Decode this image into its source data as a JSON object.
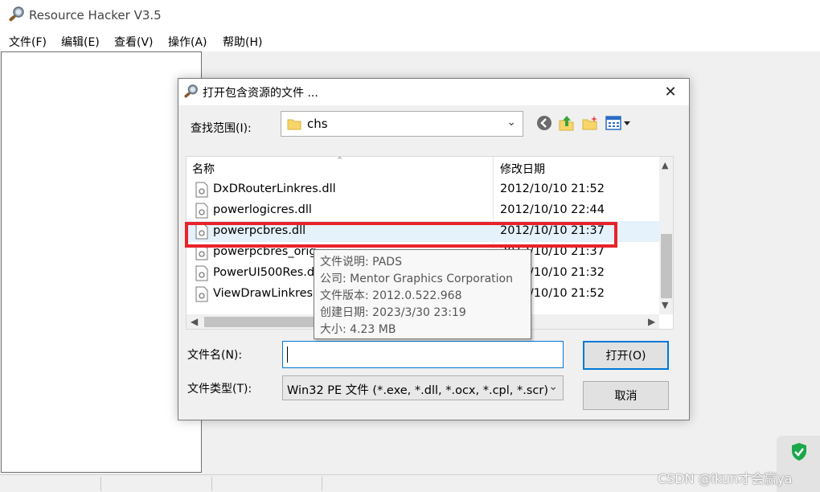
{
  "app": {
    "title": "Resource Hacker V3.5",
    "menu": [
      "文件(F)",
      "编辑(E)",
      "查看(V)",
      "操作(A)",
      "帮助(H)"
    ]
  },
  "dialog": {
    "title": "打开包含资源的文件 ...",
    "close_label": "✕",
    "look_in_label": "查找范围(I):",
    "look_in_value": "chs",
    "toolbar_icons": [
      "back-icon",
      "up-folder-icon",
      "new-folder-icon",
      "view-menu-icon"
    ],
    "columns": {
      "name": "名称",
      "modified": "修改日期"
    },
    "files": [
      {
        "name": "DxDRouterLinkres.dll",
        "date": "2012/10/10 21:52"
      },
      {
        "name": "powerlogicres.dll",
        "date": "2012/10/10 22:44"
      },
      {
        "name": "powerpcbres.dll",
        "date": "2012/10/10 21:37"
      },
      {
        "name": "powerpcbres_orig",
        "date": "2012/10/10 21:37"
      },
      {
        "name": "PowerUI500Res.d",
        "date": "2012/10/10 21:32"
      },
      {
        "name": "ViewDrawLinkres.",
        "date": "2012/10/10 21:52"
      }
    ],
    "selected_index": 2,
    "tooltip": [
      "文件说明: PADS",
      "公司: Mentor Graphics Corporation",
      "文件版本: 2012.0.522.968",
      "创建日期: 2023/3/30 23:19",
      "大小: 4.23 MB"
    ],
    "filename_label": "文件名(N):",
    "filename_value": "",
    "filetype_label": "文件类型(T):",
    "filetype_value": "Win32 PE 文件 (*.exe, *.dll, *.ocx, *.cpl, *.scr)",
    "open_label": "打开(O)",
    "cancel_label": "取消"
  },
  "watermark": "CSDN @ikun才会赢ya",
  "colors": {
    "accent": "#0078d7",
    "highlight": "#e8232a",
    "selected_row": "#e5f1fb"
  }
}
